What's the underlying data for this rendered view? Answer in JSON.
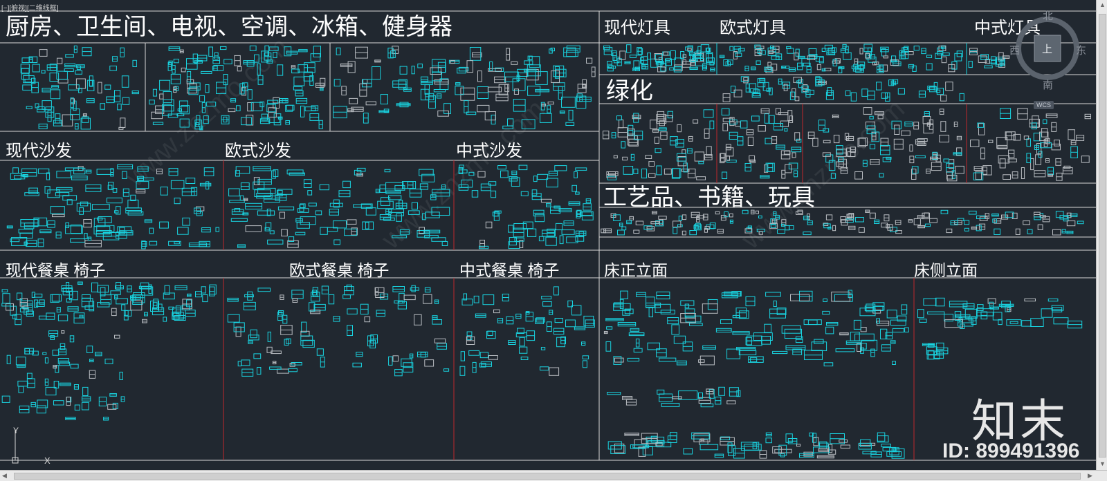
{
  "viewport": {
    "title": "[−][俯视][二维线框]"
  },
  "sections": {
    "kitchen": "厨房、卫生间、电视、空调、冰箱、健身器",
    "modern_lamps": "现代灯具",
    "euro_lamps": "欧式灯具",
    "chinese_lamps": "中式灯具",
    "greenery": "绿化",
    "modern_sofa": "现代沙发",
    "euro_sofa": "欧式沙发",
    "chinese_sofa": "中式沙发",
    "crafts": "工艺品、书籍、玩具",
    "modern_dining": "现代餐桌  椅子",
    "euro_dining": "欧式餐桌  椅子",
    "chinese_dining": "中式餐桌  椅子",
    "bed_front": "床正立面",
    "bed_side": "床侧立面"
  },
  "viewcube": {
    "north": "北",
    "south": "南",
    "east": "东",
    "west": "西",
    "top": "上",
    "wcs": "WCS"
  },
  "watermark": {
    "brand": "知末",
    "id": "ID: 899491396"
  },
  "ucs": {
    "x": "X",
    "y": "Y"
  },
  "colors": {
    "background": "#212830",
    "grid_line": "#d9d9d9",
    "divider_red": "#c0282d",
    "block_cyan": "#19d3e0",
    "block_grey": "#b9bdc2",
    "text": "#ffffff"
  }
}
